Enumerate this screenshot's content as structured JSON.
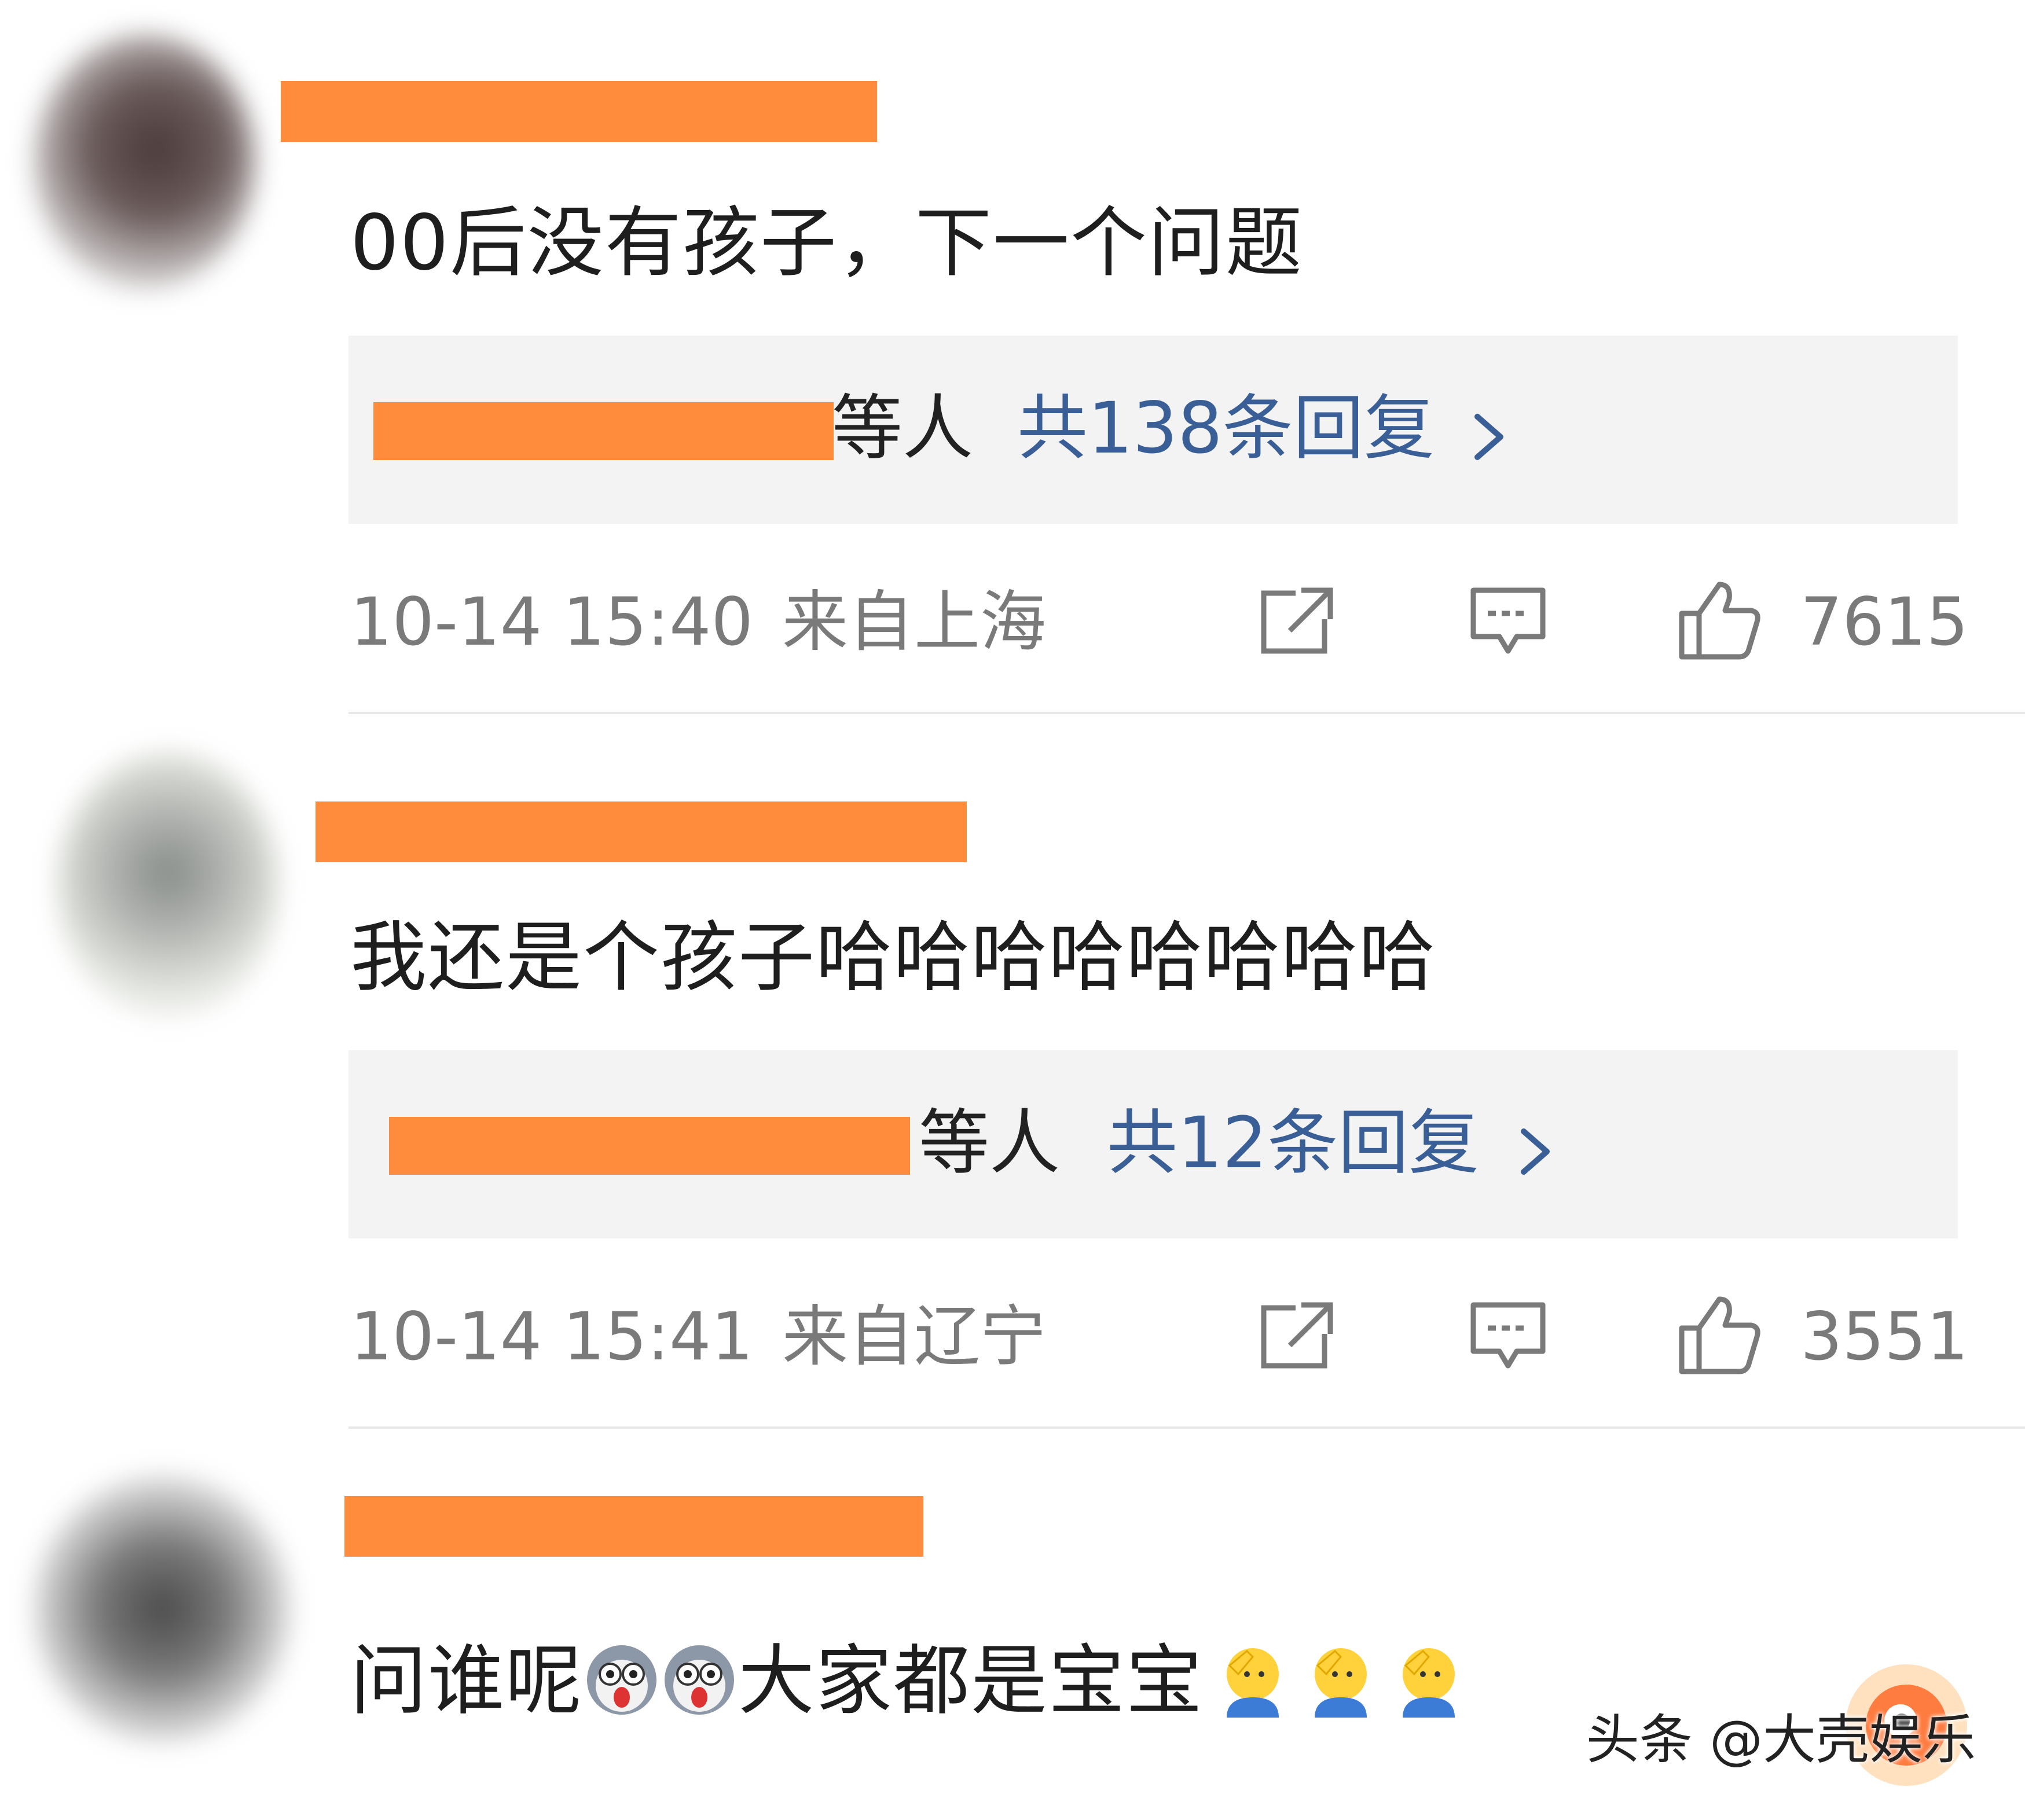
{
  "comments": [
    {
      "text": "00后没有孩子，下一个问题",
      "reply_tail": "等人",
      "reply_count": "共138条回复",
      "time": "10-14 15:40",
      "location": "来自上海",
      "likes": "7615"
    },
    {
      "text": "我还是个孩子哈哈哈哈哈哈哈哈",
      "reply_tail": "等人",
      "reply_count": "共12条回复",
      "time": "10-14 15:41",
      "location": "来自辽宁",
      "likes": "3551"
    },
    {
      "text_part1": "问谁呢",
      "text_part2": "大家都是宝宝"
    }
  ],
  "watermark": "头条 @大壳娱乐",
  "colors": {
    "redaction": "#ff8c3c",
    "reply_link": "#3a5f97",
    "meta_text": "#7a7a7a",
    "reply_bg": "#f3f3f3"
  },
  "icons": [
    "share-icon",
    "comment-icon",
    "like-icon",
    "chevron-right-icon",
    "shocked-dog-emoji",
    "salute-emoji"
  ]
}
